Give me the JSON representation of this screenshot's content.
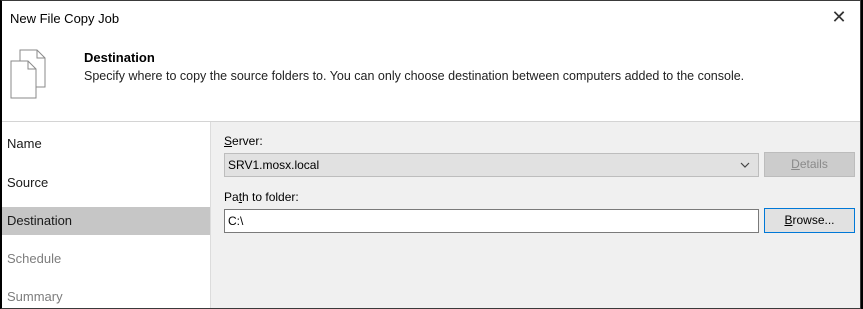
{
  "window": {
    "title": "New File Copy Job",
    "close_glyph": "✕"
  },
  "header": {
    "icon": "copy-document-icon",
    "title": "Destination",
    "description": "Specify where to copy the source folders to. You can only choose destination between computers added to the console."
  },
  "nav": {
    "items": [
      {
        "label": "Name",
        "state": "normal"
      },
      {
        "label": "Source",
        "state": "normal"
      },
      {
        "label": "Destination",
        "state": "active"
      },
      {
        "label": "Schedule",
        "state": "disabled"
      },
      {
        "label": "Summary",
        "state": "disabled"
      }
    ]
  },
  "form": {
    "server": {
      "label_ul": "S",
      "label_rest": "erver:",
      "value": "SRV1.mosx.local",
      "details_ul": "D",
      "details_rest": "etails"
    },
    "path": {
      "label_pre": "Pa",
      "label_ul": "t",
      "label_rest": "h to folder:",
      "value": "C:\\",
      "browse_ul": "B",
      "browse_rest": "rowse..."
    }
  },
  "colors": {
    "nav_active_bg": "#c6c6c6",
    "content_bg": "#f0f0f0",
    "browse_focus_border": "#0078d7"
  }
}
